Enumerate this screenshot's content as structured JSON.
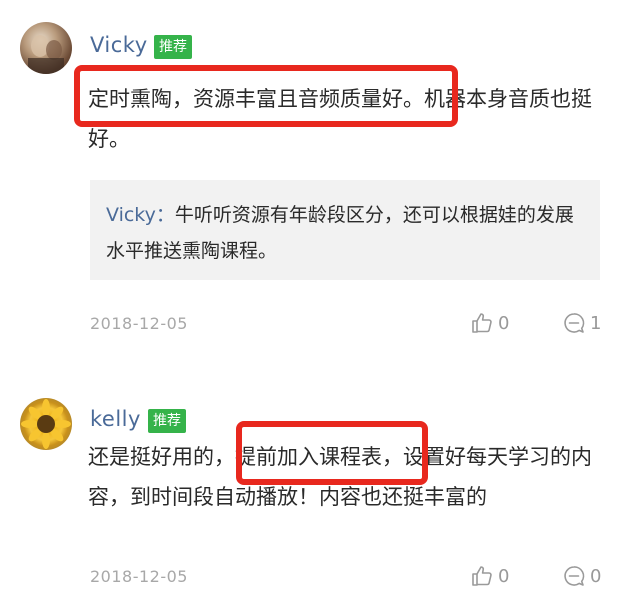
{
  "comments": [
    {
      "username": "Vicky",
      "badge": "推荐",
      "content": "定时熏陶，资源丰富且音频质量好。机器本身音质也挺好。",
      "reply": {
        "author": "Vicky：",
        "text": "牛听听资源有年龄段区分，还可以根据娃的发展水平推送熏陶课程。"
      },
      "date": "2018-12-05",
      "likes": "0",
      "replies": "1"
    },
    {
      "username": "kelly",
      "badge": "推荐",
      "content": "还是挺好用的，提前加入课程表，设置好每天学习的内容，到时间段自动播放！内容也还挺丰富的",
      "date": "2018-12-05",
      "likes": "0",
      "replies": "0"
    }
  ],
  "icons": {
    "like": "thumbs-up-icon",
    "reply": "comment-bubble-icon"
  },
  "colors": {
    "username": "#4a6a98",
    "badge": "#35b34a",
    "highlight": "#e8281e",
    "reply_bg": "#f2f2f2",
    "meta": "#a8a8a8"
  }
}
